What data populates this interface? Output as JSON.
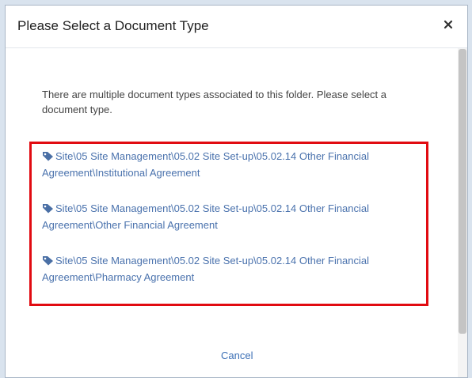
{
  "dialog": {
    "title": "Please Select a Document Type",
    "close_label": "×",
    "intro_text": "There are multiple document types associated to this folder. Please select a document type.",
    "document_types": [
      {
        "label": "Site\\05 Site Management\\05.02 Site Set-up\\05.02.14 Other Financial Agreement\\Institutional Agreement",
        "icon": "tag-icon"
      },
      {
        "label": "Site\\05 Site Management\\05.02 Site Set-up\\05.02.14 Other Financial Agreement\\Other Financial Agreement",
        "icon": "tag-icon"
      },
      {
        "label": "Site\\05 Site Management\\05.02 Site Set-up\\05.02.14 Other Financial Agreement\\Pharmacy Agreement",
        "icon": "tag-icon"
      }
    ],
    "cancel_label": "Cancel"
  },
  "colors": {
    "link": "#4a72ad",
    "highlight_border": "#e10b11",
    "background": "#d9e3ee"
  }
}
